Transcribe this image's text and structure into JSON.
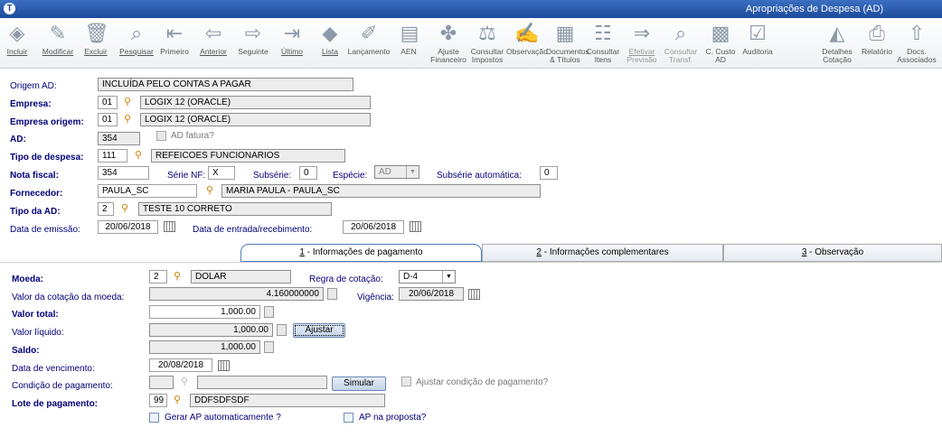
{
  "window": {
    "title": "Apropriações de Despesa (AD)"
  },
  "toolbar": {
    "incluir": "Incluir",
    "modificar": "Modificar",
    "excluir": "Excluir",
    "pesquisar": "Pesquisar",
    "primeiro": "Primeiro",
    "anterior": "Anterior",
    "seguinte": "Seguinte",
    "ultimo": "Último",
    "lista": "Lista",
    "lancamento": "Lançamento",
    "aen": "AEN",
    "ajuste1": "Ajuste",
    "ajuste2": "Financeiro",
    "consimp1": "Consultar",
    "consimp2": "Impostos",
    "observacao": "Observação",
    "doc1": "Documentos",
    "doc2": "& Títulos",
    "consitens1": "Consultar",
    "consitens2": "Itens",
    "efet1": "Efetivar",
    "efet2": "Previsão",
    "constransf1": "Consultar",
    "constransf2": "Transf.",
    "ccusto1": "C. Custo",
    "ccusto2": "AD",
    "auditoria": "Auditoria",
    "detalhe1": "Detalhes",
    "detalhe2": "Cotação",
    "relatorio": "Relatório",
    "docs1": "Docs.",
    "docs2": "Associados"
  },
  "header": {
    "origem_label": "Origem AD:",
    "origem_value": "INCLUÍDA PELO CONTAS A PAGAR",
    "empresa_label": "Empresa:",
    "empresa_code": "01",
    "empresa_name": "LOGIX 12 (ORACLE)",
    "empresa_origem_label": "Empresa origem:",
    "empresa_origem_code": "01",
    "empresa_origem_name": "LOGIX 12 (ORACLE)",
    "ad_label": "AD:",
    "ad_value": "354",
    "ad_fatura_label": "AD fatura?",
    "tipo_despesa_label": "Tipo de despesa:",
    "tipo_despesa_code": "111",
    "tipo_despesa_name": "REFEICOES FUNCIONARIOS",
    "nota_label": "Nota fiscal:",
    "nota_value": "354",
    "serie_label": "Série NF:",
    "serie_value": "X",
    "subserie_label": "Subsérie:",
    "subserie_value": "0",
    "especie_label": "Espécie:",
    "especie_value": "AD",
    "subserie_auto_label": "Subsérie automática:",
    "subserie_auto_value": "0",
    "fornecedor_label": "Fornecedor:",
    "fornecedor_code": "PAULA_SC",
    "fornecedor_name": "MARIA PAULA - PAULA_SC",
    "tipo_ad_label": "Tipo da AD:",
    "tipo_ad_code": "2",
    "tipo_ad_name": "TESTE 10 CORRETO",
    "emissao_label": "Data de emissão:",
    "emissao_value": "20/06/2018",
    "entrada_label": "Data de entrada/recebimento:",
    "entrada_value": "20/06/2018"
  },
  "tabs": [
    {
      "num": "1",
      "label": " - Informações de pagamento"
    },
    {
      "num": "2",
      "label": " - Informações complementares"
    },
    {
      "num": "3",
      "label": " - Observação"
    }
  ],
  "payment": {
    "moeda_label": "Moeda:",
    "moeda_code": "2",
    "moeda_name": "DOLAR",
    "regra_label": "Regra de cotação:",
    "regra_value": "D-4",
    "cotacao_label": "Valor da cotação da moeda:",
    "cotacao_value": "4.160000000",
    "vigencia_label": "Vigência:",
    "vigencia_value": "20/06/2018",
    "total_label": "Valor total:",
    "total_value": "1,000.00",
    "liquido_label": "Valor líquido:",
    "liquido_value": "1,000.00",
    "ajustar_label": "Ajustar",
    "saldo_label": "Saldo:",
    "saldo_value": "1,000.00",
    "vencimento_label": "Data de vencimento:",
    "vencimento_value": "20/08/2018",
    "condicao_label": "Condição de pagamento:",
    "simular_label": "Simular",
    "ajustar_cond_label": "Ajustar condição de pagamento?",
    "lote_label": "Lote de pagamento:",
    "lote_code": "99",
    "lote_name": "DDFSDFSDF",
    "gerar_ap_label": "Gerar AP automaticamente ?",
    "ap_proposta_label": "AP na proposta?"
  }
}
